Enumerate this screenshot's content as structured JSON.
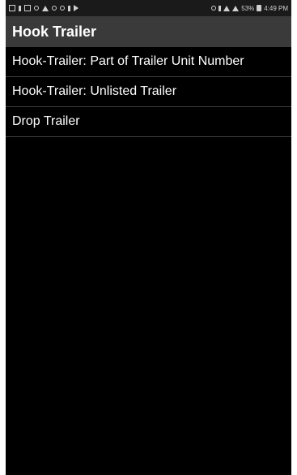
{
  "status_bar": {
    "left_icons": [
      "notification-icon",
      "sim-icon",
      "image-icon",
      "cast-icon",
      "android-icon",
      "settings-icon",
      "bug-icon",
      "sim-icon",
      "play-store-icon"
    ],
    "right_icons": [
      "location-icon",
      "bluetooth-icon",
      "wifi-icon",
      "signal-icon",
      "battery-icon"
    ],
    "battery": "53%",
    "time": "4:49 PM"
  },
  "app_bar": {
    "title": "Hook Trailer"
  },
  "list": [
    {
      "label": "Hook-Trailer: Part of Trailer Unit Number"
    },
    {
      "label": "Hook-Trailer: Unlisted Trailer"
    },
    {
      "label": "Drop Trailer"
    }
  ],
  "colors": {
    "background": "#000000",
    "app_bar": "#3a3a3a",
    "status_bar": "#1a1a1a",
    "text": "#ffffff",
    "divider": "#333333"
  }
}
